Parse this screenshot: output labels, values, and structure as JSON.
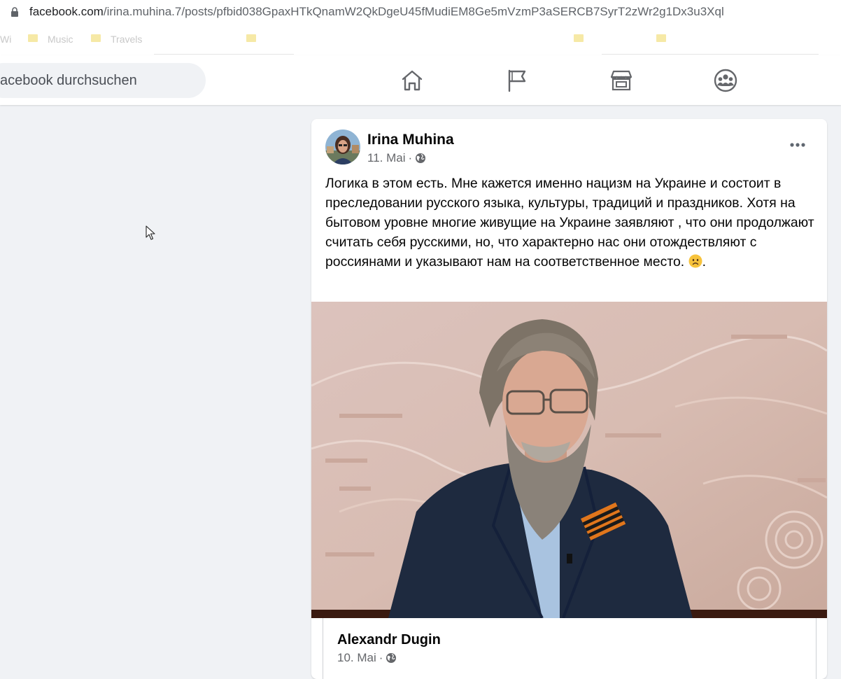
{
  "browser": {
    "url_host": "facebook.com",
    "url_path": "/irina.muhina.7/posts/pfbid038GpaxHTkQnamW2QkDgeU45fMudiEM8Ge5mVzmP3aSERCB7SyrT2zWr2g1Dx3u3Xql",
    "bookmarks": [
      "Wi",
      "Music",
      "Travels"
    ]
  },
  "header": {
    "search_placeholder": "acebook durchsuchen",
    "nav": [
      "home-icon",
      "pages-flag-icon",
      "marketplace-icon",
      "groups-icon"
    ]
  },
  "post": {
    "author": "Irina Muhina",
    "date": "11. Mai",
    "audience_icon": "globe-icon",
    "text": "Логика в этом есть. Мне кажется именно нацизм на Украине и состоит в преследовании русского языка, культуры, традиций и праздников. Хотя на бытовом уровне многие живущие на Украине заявляют , что они продолжают считать себя русскими, но, что характерно нас они отождествляют с россиянами и указывают нам на соответственное место.",
    "text_end": ".",
    "emoji": "frowning-face-emoji",
    "shared": {
      "author": "Alexandr Dugin",
      "date": "10. Mai"
    }
  },
  "colors": {
    "page_bg": "#f0f2f5",
    "card_bg": "#ffffff",
    "secondary_text": "#65676b",
    "icon": "#65676b"
  }
}
